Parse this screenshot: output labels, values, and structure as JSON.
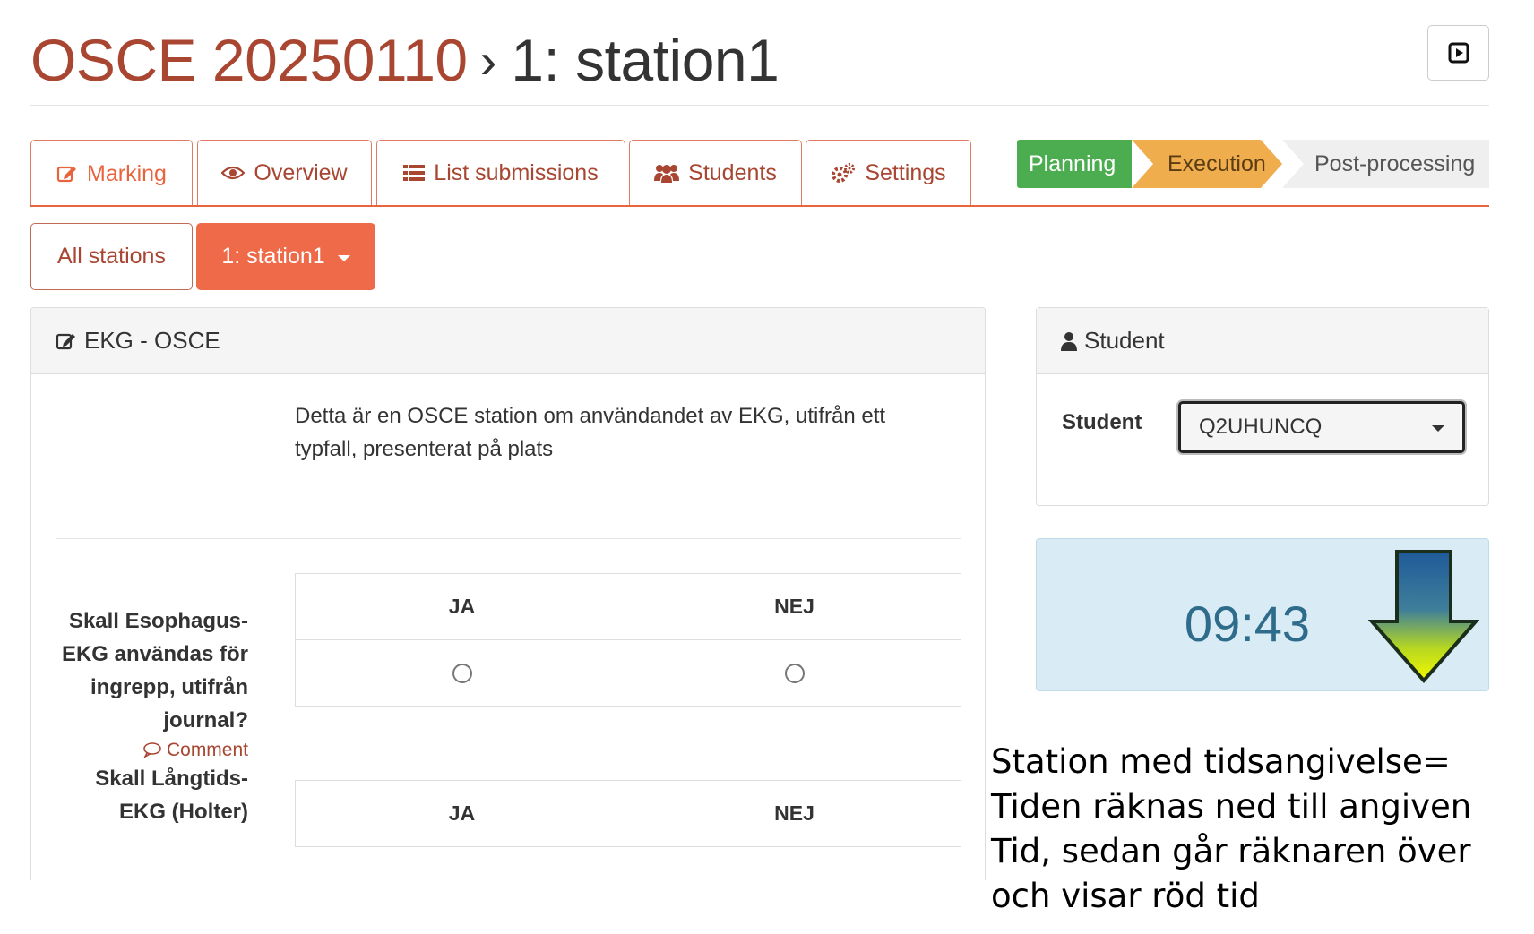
{
  "header": {
    "breadcrumb_parent": "OSCE 20250110",
    "separator": "›",
    "breadcrumb_current": "1: station1",
    "present_icon": "play-square-icon"
  },
  "tabs": [
    {
      "label": "Marking",
      "icon": "edit-icon",
      "active": true
    },
    {
      "label": "Overview",
      "icon": "eye-icon",
      "active": false
    },
    {
      "label": "List submissions",
      "icon": "list-icon",
      "active": false
    },
    {
      "label": "Students",
      "icon": "users-icon",
      "active": false
    },
    {
      "label": "Settings",
      "icon": "gears-icon",
      "active": false
    }
  ],
  "workflow": {
    "steps": [
      "Planning",
      "Execution",
      "Post-processing"
    ],
    "colors": {
      "planning": "#4cad50",
      "execution": "#f0ad4e",
      "post": "#efefef"
    }
  },
  "stations": {
    "all_label": "All stations",
    "current_label": "1: station1"
  },
  "main_panel": {
    "title": "EKG - OSCE",
    "description": "Detta är en OSCE station om användandet av EKG, utifrån ett typfall, presenterat på plats",
    "questions": [
      {
        "text": "Skall Esophagus-EKG användas för ingrepp, utifrån journal?",
        "comment": "Comment",
        "options": [
          "JA",
          "NEJ"
        ]
      },
      {
        "text": "Skall Långtids-EKG (Holter)",
        "options": [
          "JA",
          "NEJ"
        ]
      }
    ]
  },
  "student_panel": {
    "title": "Student",
    "field_label": "Student",
    "selected": "Q2UHUNCQ"
  },
  "timer": {
    "value": "09:43",
    "arrow_icon": "down-arrow-icon"
  },
  "annotation": {
    "text": "Station med tidsangivelse= Tiden räknas ned till angiven Tid, sedan går räknaren över och visar röd tid"
  },
  "colors": {
    "brand": "#a84632",
    "accent": "#ee6a48"
  }
}
